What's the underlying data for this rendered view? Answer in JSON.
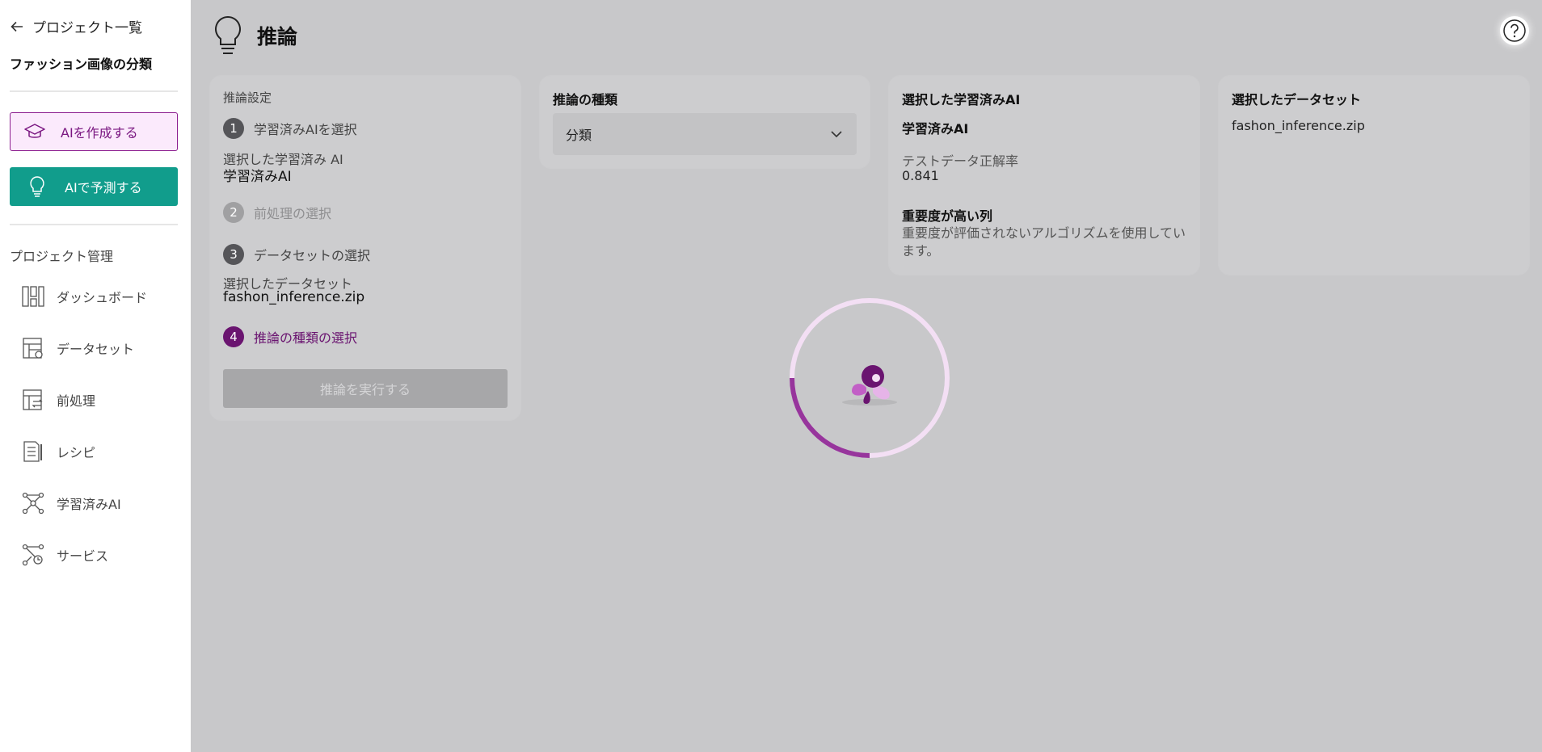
{
  "sidebar": {
    "back_label": "プロジェクト一覧",
    "project_name": "ファッション画像の分類",
    "create_ai_label": "AIを作成する",
    "predict_ai_label": "AIで予測する",
    "section_label": "プロジェクト管理",
    "nav": [
      {
        "label": "ダッシュボード",
        "icon": "dashboard-icon"
      },
      {
        "label": "データセット",
        "icon": "dataset-icon"
      },
      {
        "label": "前処理",
        "icon": "preprocess-icon"
      },
      {
        "label": "レシピ",
        "icon": "recipe-icon"
      },
      {
        "label": "学習済みAI",
        "icon": "trained-ai-icon"
      },
      {
        "label": "サービス",
        "icon": "service-icon"
      }
    ]
  },
  "header": {
    "title": "推論",
    "icon": "lightbulb-icon"
  },
  "settings": {
    "title": "推論設定",
    "steps": [
      {
        "num": "1",
        "label": "学習済みAIを選択",
        "state": "done"
      },
      {
        "num": "2",
        "label": "前処理の選択",
        "state": "disabled"
      },
      {
        "num": "3",
        "label": "データセットの選択",
        "state": "done"
      },
      {
        "num": "4",
        "label": "推論の種類の選択",
        "state": "active"
      }
    ],
    "selected_ai_label": "選択した学習済み AI",
    "selected_ai_value": "学習済みAI",
    "selected_ds_label": "選択したデータセット",
    "selected_ds_value": "fashon_inference.zip",
    "run_label": "推論を実行する"
  },
  "inference_type": {
    "title": "推論の種類",
    "selected": "分類"
  },
  "selected_ai": {
    "title": "選択した学習済みAI",
    "name": "学習済みAI",
    "accuracy_label": "テストデータ正解率",
    "accuracy_value": "0.841",
    "importance_title": "重要度が高い列",
    "importance_text": "重要度が評価されないアルゴリズムを使用しています。"
  },
  "selected_dataset": {
    "title": "選択したデータセット",
    "name": "fashon_inference.zip"
  },
  "colors": {
    "accent": "#6a1470",
    "teal": "#119d8c",
    "overlay": "#c8c8ca"
  }
}
